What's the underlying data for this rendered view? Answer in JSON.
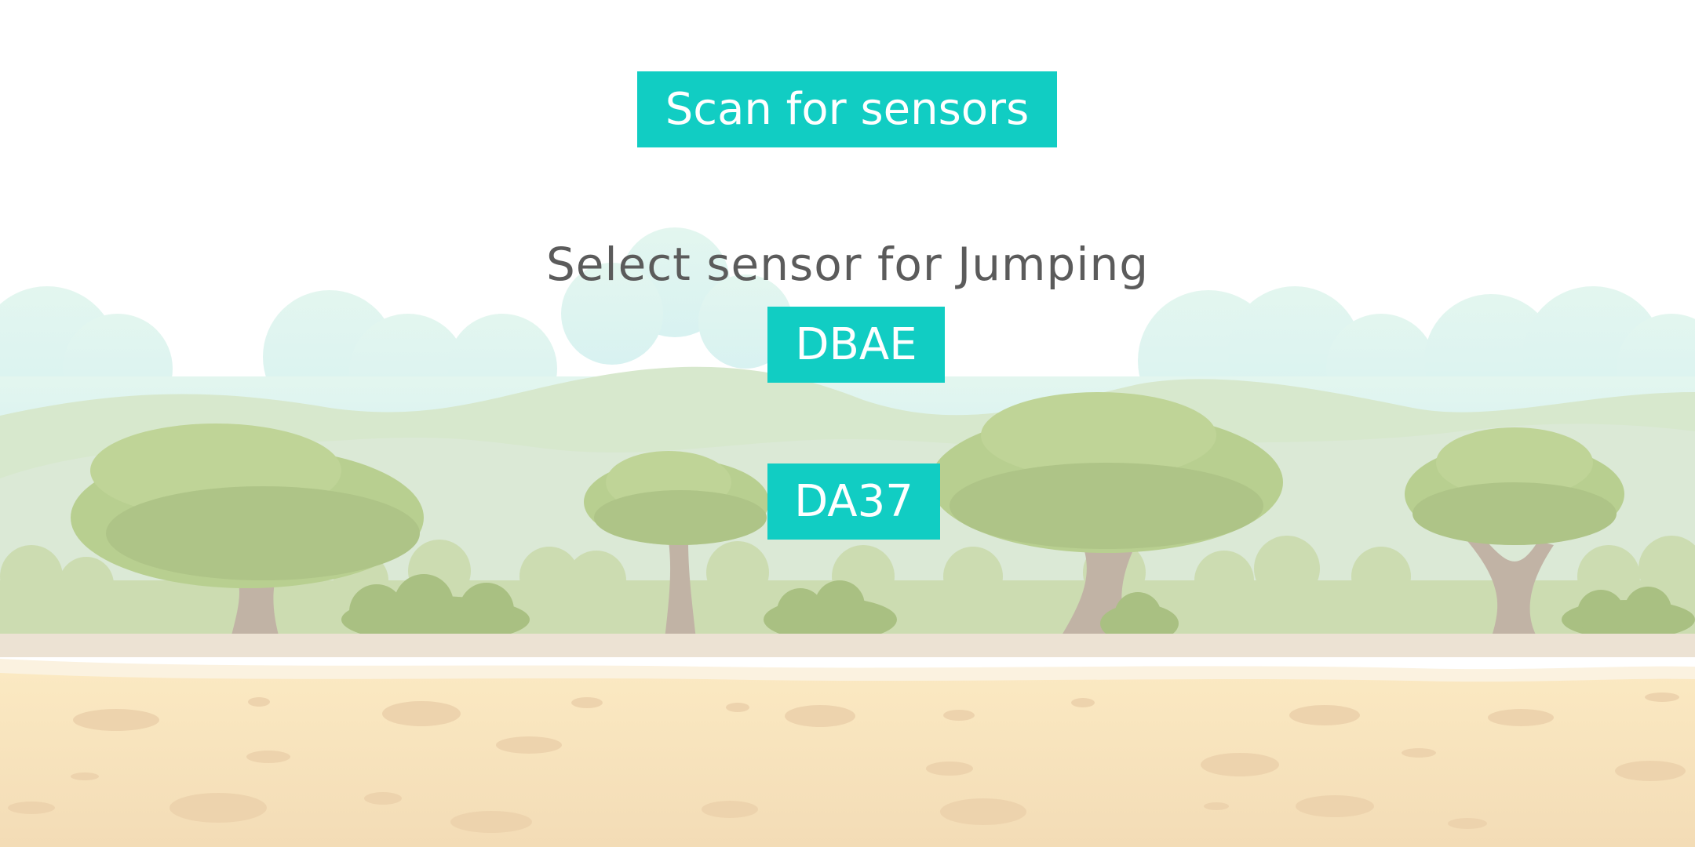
{
  "scan_button": {
    "label": "Scan for sensors"
  },
  "heading": {
    "text": "Select sensor for Jumping"
  },
  "sensors": [
    {
      "label": "DBAE"
    },
    {
      "label": "DA37"
    }
  ],
  "colors": {
    "button": "#11cdc3",
    "heading_text": "#5b5b5b",
    "ground": "#f6e3b9",
    "foliage": "#b9cf91"
  },
  "background": {
    "theme": "savanna-landscape"
  }
}
